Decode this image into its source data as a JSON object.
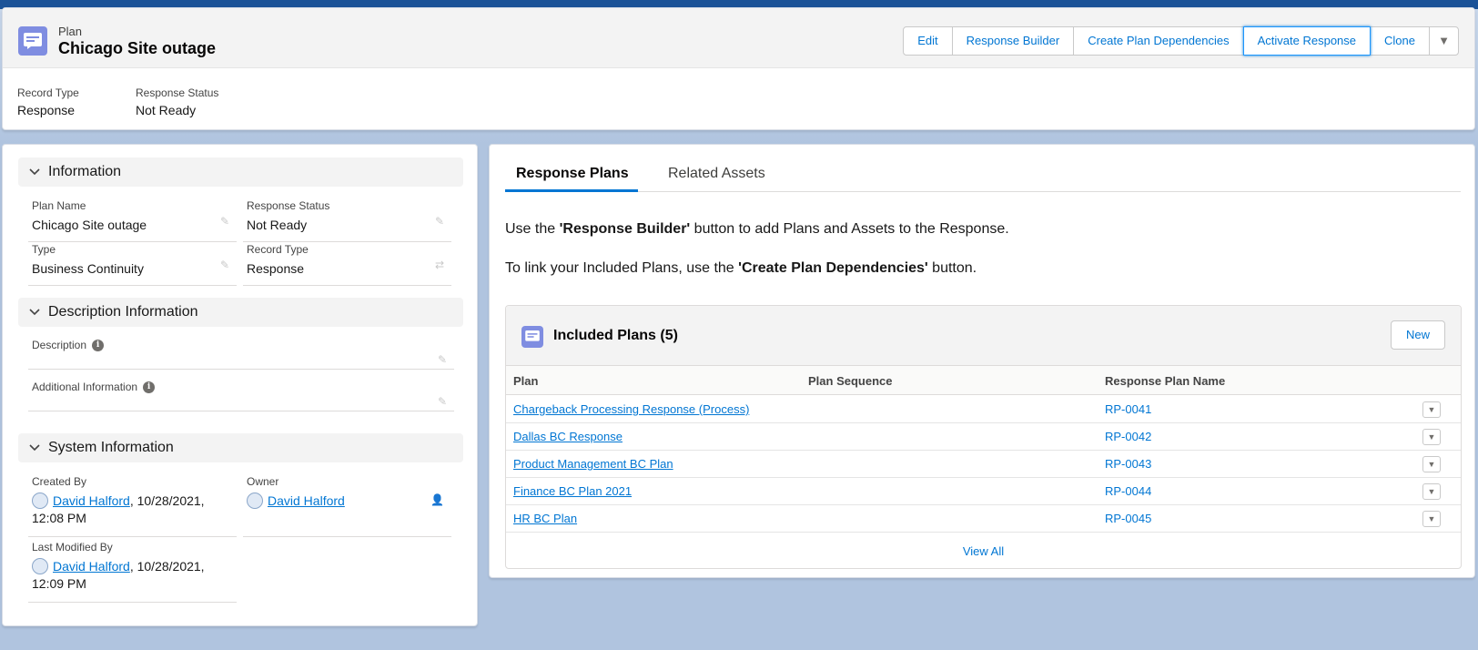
{
  "header": {
    "object_label": "Plan",
    "record_title": "Chicago Site outage",
    "buttons": [
      "Edit",
      "Response Builder",
      "Create Plan Dependencies",
      "Activate Response",
      "Clone"
    ],
    "more_icon": "chevron-down-icon",
    "highlights": [
      {
        "label": "Record Type",
        "value": "Response"
      },
      {
        "label": "Response Status",
        "value": "Not Ready"
      }
    ]
  },
  "details": {
    "information": {
      "title": "Information",
      "plan_name_label": "Plan Name",
      "plan_name": "Chicago Site outage",
      "response_status_label": "Response Status",
      "response_status": "Not Ready",
      "type_label": "Type",
      "type": "Business Continuity",
      "record_type_label": "Record Type",
      "record_type": "Response"
    },
    "description": {
      "title": "Description Information",
      "description_label": "Description",
      "description": "",
      "additional_label": "Additional Information",
      "additional": ""
    },
    "system": {
      "title": "System Information",
      "created_by_label": "Created By",
      "created_by_user": "David Halford",
      "created_by_date": ", 10/28/2021,",
      "created_by_time": "12:08 PM",
      "owner_label": "Owner",
      "owner": "David Halford",
      "modified_by_label": "Last Modified By",
      "modified_by_user": "David Halford",
      "modified_by_date": ", 10/28/2021,",
      "modified_by_time": "12:09 PM"
    }
  },
  "related": {
    "tabs": [
      "Response Plans",
      "Related Assets"
    ],
    "active_tab": "Response Plans",
    "message1_pre": "Use the ",
    "message1_bold": "'Response Builder'",
    "message1_post": " button to add Plans and Assets to the Response.",
    "message2_pre": "To link your Included Plans, use the ",
    "message2_bold": "'Create Plan Dependencies'",
    "message2_post": " button.",
    "list": {
      "title": "Included Plans (5)",
      "new_label": "New",
      "columns": [
        "Plan",
        "Plan Sequence",
        "Response Plan Name"
      ],
      "rows": [
        {
          "plan": "Chargeback Processing Response (Process)",
          "sequence": "",
          "name": "RP-0041"
        },
        {
          "plan": "Dallas BC Response",
          "sequence": "",
          "name": "RP-0042"
        },
        {
          "plan": "Product Management BC Plan",
          "sequence": "",
          "name": "RP-0043"
        },
        {
          "plan": "Finance BC Plan 2021",
          "sequence": "",
          "name": "RP-0044"
        },
        {
          "plan": "HR BC Plan",
          "sequence": "",
          "name": "RP-0045"
        }
      ],
      "view_all": "View All"
    }
  },
  "colors": {
    "brand": "#0176d3",
    "icon_bg": "#7f8de1",
    "top_band": "#1b5297",
    "page_bg": "#b0c4df"
  }
}
